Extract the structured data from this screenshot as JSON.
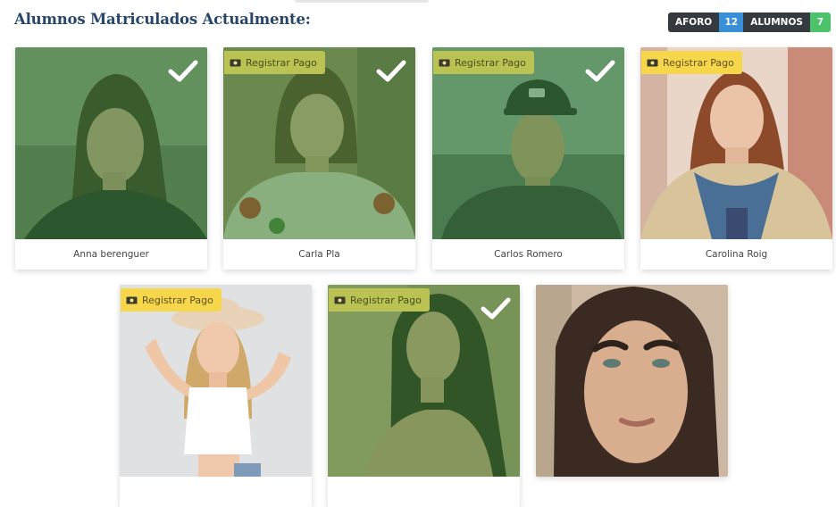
{
  "header": {
    "title": "Alumnos Matriculados Actualmente:"
  },
  "stats": {
    "capacity_label": "AFORO",
    "capacity_value": "12",
    "enrolled_label": "ALUMNOS",
    "enrolled_value": "7"
  },
  "colors": {
    "title": "#26466a",
    "badge_yellow": "#f6d64a",
    "paid_overlay": "#3a8c37",
    "capacity": "#3a8fd9",
    "enrolled": "#4cc26a"
  },
  "students": [
    {
      "name": "Anna berenguer",
      "paid": true,
      "pay_label": ""
    },
    {
      "name": "Carla Pla",
      "paid": true,
      "pay_label": "Registrar Pago"
    },
    {
      "name": "Carlos Romero",
      "paid": true,
      "pay_label": "Registrar Pago"
    },
    {
      "name": "Carolina Roig",
      "paid": false,
      "pay_label": "Registrar Pago"
    },
    {
      "name": "",
      "paid": false,
      "pay_label": "Registrar Pago"
    },
    {
      "name": "",
      "paid": true,
      "pay_label": "Registrar Pago"
    },
    {
      "name": "",
      "paid": false,
      "pay_label": ""
    }
  ]
}
